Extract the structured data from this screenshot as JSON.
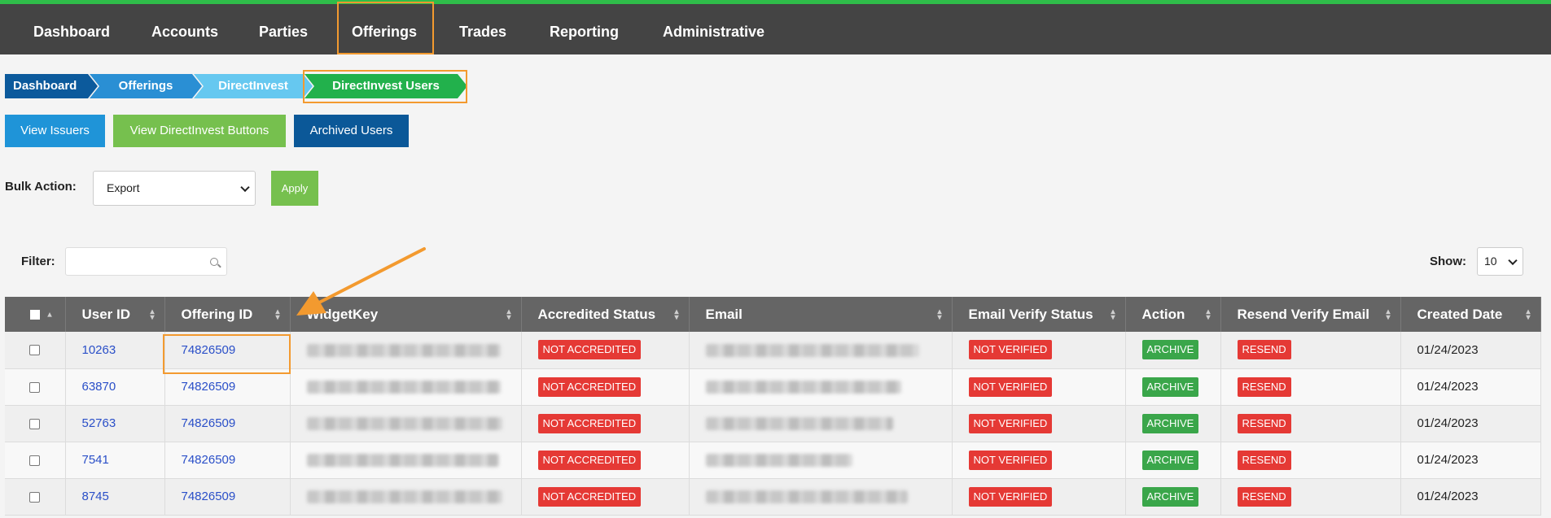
{
  "nav": {
    "items": [
      "Dashboard",
      "Accounts",
      "Parties",
      "Offerings",
      "Trades",
      "Reporting",
      "Administrative"
    ]
  },
  "breadcrumb": [
    "Dashboard",
    "Offerings",
    "DirectInvest",
    "DirectInvest Users"
  ],
  "buttons": {
    "view_issuers": "View Issuers",
    "view_buttons": "View DirectInvest Buttons",
    "archived_users": "Archived Users"
  },
  "bulk": {
    "label": "Bulk Action:",
    "selected": "Export",
    "apply": "Apply"
  },
  "filter": {
    "label": "Filter:",
    "value": ""
  },
  "show": {
    "label": "Show:",
    "selected": "10"
  },
  "table": {
    "columns": [
      "User ID",
      "Offering ID",
      "WidgetKey",
      "Accredited Status",
      "Email",
      "Email Verify Status",
      "Action",
      "Resend Verify Email",
      "Created Date"
    ],
    "rows": [
      {
        "user_id": "10263",
        "offering_id": "74826509",
        "accredited": "NOT ACCREDITED",
        "verify": "NOT VERIFIED",
        "action": "ARCHIVE",
        "resend": "RESEND",
        "created": "01/24/2023"
      },
      {
        "user_id": "63870",
        "offering_id": "74826509",
        "accredited": "NOT ACCREDITED",
        "verify": "NOT VERIFIED",
        "action": "ARCHIVE",
        "resend": "RESEND",
        "created": "01/24/2023"
      },
      {
        "user_id": "52763",
        "offering_id": "74826509",
        "accredited": "NOT ACCREDITED",
        "verify": "NOT VERIFIED",
        "action": "ARCHIVE",
        "resend": "RESEND",
        "created": "01/24/2023"
      },
      {
        "user_id": "7541",
        "offering_id": "74826509",
        "accredited": "NOT ACCREDITED",
        "verify": "NOT VERIFIED",
        "action": "ARCHIVE",
        "resend": "RESEND",
        "created": "01/24/2023"
      },
      {
        "user_id": "8745",
        "offering_id": "74826509",
        "accredited": "NOT ACCREDITED",
        "verify": "NOT VERIFIED",
        "action": "ARCHIVE",
        "resend": "RESEND",
        "created": "01/24/2023"
      }
    ]
  },
  "colors": {
    "nav_bg": "#444444",
    "accent_green": "#2fbd4a",
    "highlight_orange": "#f39a2f",
    "link_blue": "#2a4fc8",
    "badge_red": "#e53935",
    "badge_green": "#3aa64a"
  }
}
